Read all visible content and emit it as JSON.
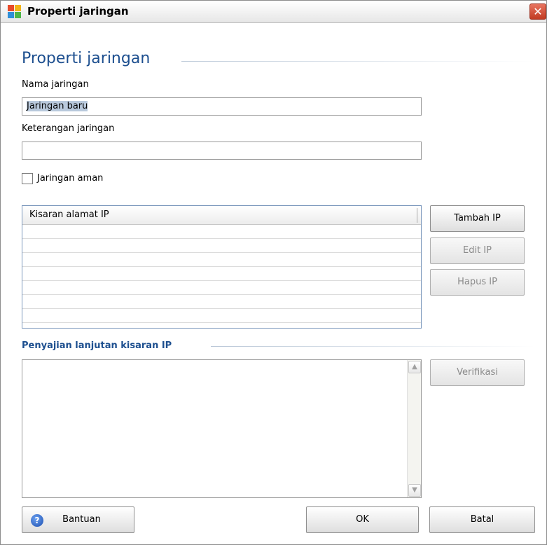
{
  "window": {
    "title": "Properti jaringan",
    "close_glyph": "✕",
    "icon": "app-logo-icon"
  },
  "form": {
    "heading": "Properti jaringan",
    "name_label": "Nama jaringan",
    "name_value": "Jaringan baru",
    "desc_label": "Keterangan jaringan",
    "desc_value": "",
    "secure_label": "Jaringan aman",
    "secure_checked": false
  },
  "ip_list": {
    "column_header": "Kisaran alamat IP",
    "rows": [
      "",
      "",
      "",
      "",
      "",
      "",
      ""
    ]
  },
  "ip_buttons": {
    "add": "Tambah IP",
    "edit": "Edit IP",
    "remove": "Hapus IP"
  },
  "advanced": {
    "title": "Penyajian lanjutan kisaran IP",
    "text": "",
    "verify": "Verifikasi"
  },
  "footer": {
    "help": "Bantuan",
    "ok": "OK",
    "cancel": "Batal",
    "help_icon_glyph": "?"
  },
  "colors": {
    "accent": "#1d4f8f",
    "list_border": "#7b97bc",
    "close_red": "#c13b22"
  }
}
